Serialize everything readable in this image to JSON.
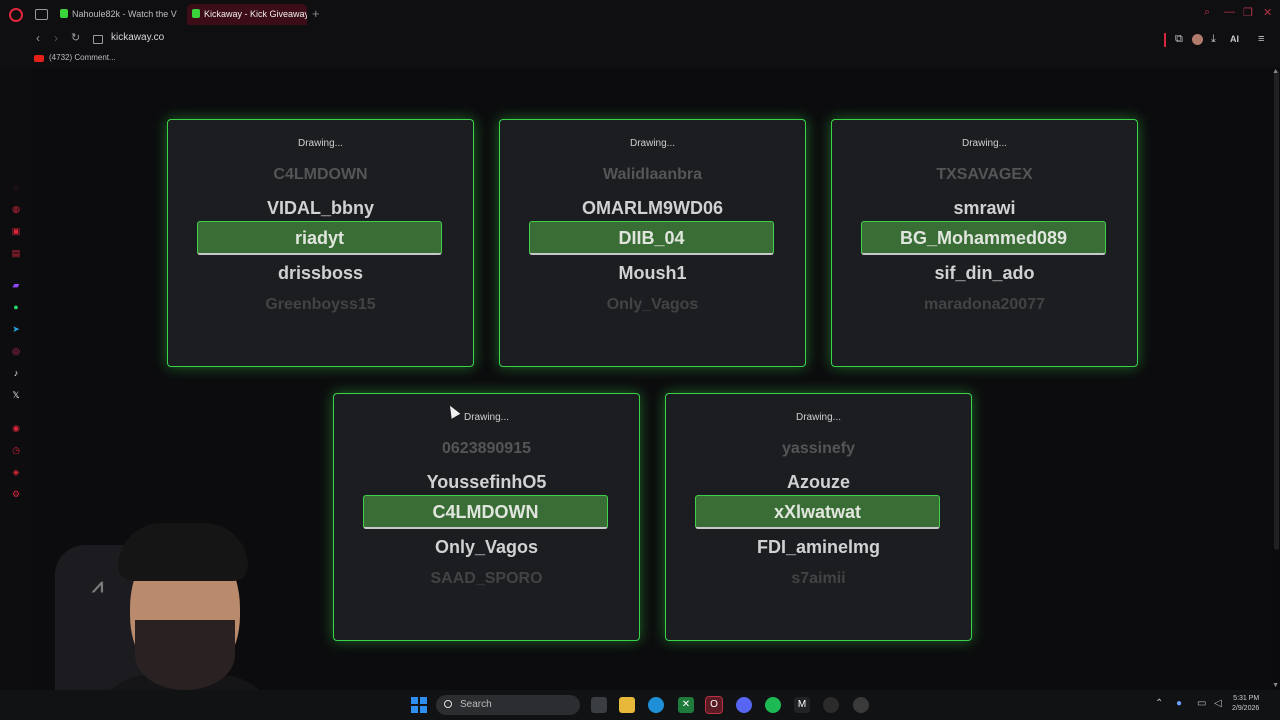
{
  "browser": {
    "tabs": [
      {
        "label": "Nahoule82k - Watch the V",
        "active": false
      },
      {
        "label": "Kickaway - Kick Giveaway",
        "active": true
      }
    ],
    "url": "kickaway.co",
    "ai_label": "AI",
    "bookmark": "(4732) Comment..."
  },
  "cards": [
    {
      "status": "Drawing...",
      "entries": [
        "C4LMDOWN",
        "VIDAL_bbny",
        "riadyt",
        "drissboss",
        "Greenboyss15"
      ]
    },
    {
      "status": "Drawing...",
      "entries": [
        "Walidlaanbra",
        "OMARLM9WD06",
        "DIIB_04",
        "Moush1",
        "Only_Vagos"
      ]
    },
    {
      "status": "Drawing...",
      "entries": [
        "TXSAVAGEX",
        "smrawi",
        "BG_Mohammed089",
        "sif_din_ado",
        "maradona20077"
      ]
    },
    {
      "status": "Drawing...",
      "entries": [
        "0623890915",
        "YoussefinhO5",
        "C4LMDOWN",
        "Only_Vagos",
        "SAAD_SPORO"
      ]
    },
    {
      "status": "Drawing...",
      "entries": [
        "yassinefy",
        "Azouze",
        "xXlwatwat",
        "FDI_aminelmg",
        "s7aimii"
      ]
    }
  ],
  "taskbar": {
    "search_placeholder": "Search",
    "time": "5:31 PM",
    "date": "2/9/2026"
  },
  "colors": {
    "accent": "#39d44a",
    "winner_bg": "#3a6d35",
    "opera_red": "#e0263a"
  }
}
